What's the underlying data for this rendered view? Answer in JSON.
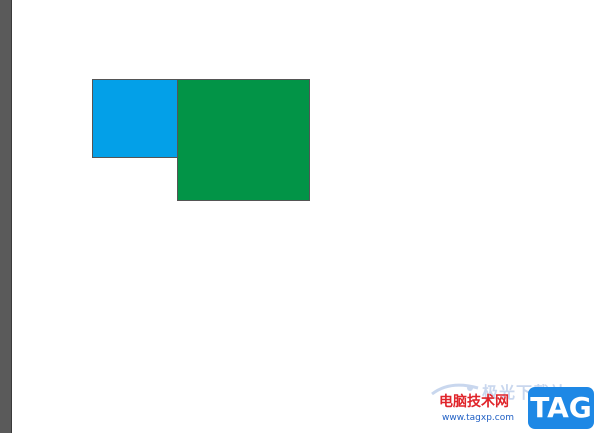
{
  "canvas": {
    "background": "#ffffff",
    "sidebar_color": "#5a5a5a"
  },
  "shapes": [
    {
      "name": "blue-rectangle",
      "fill": "#03a0e8"
    },
    {
      "name": "green-square",
      "fill": "#029447"
    }
  ],
  "watermark": {
    "faded_text": "极光下载站",
    "cn_text": "电脑技术网",
    "url": "www.tagxp.com",
    "badge": "TAG",
    "badge_color": "#1e88e5"
  }
}
